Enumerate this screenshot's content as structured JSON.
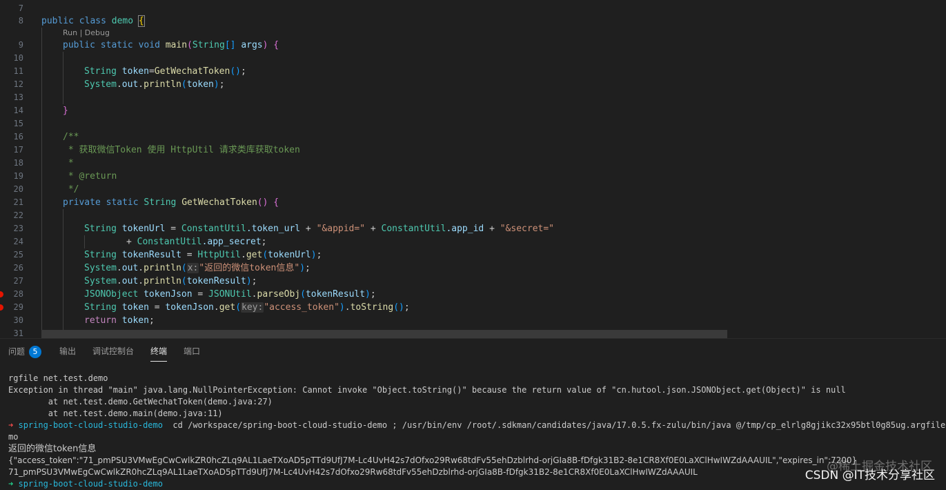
{
  "editor": {
    "line_numbers": [
      "7",
      "8",
      "9",
      "10",
      "11",
      "12",
      "13",
      "14",
      "15",
      "16",
      "17",
      "18",
      "19",
      "20",
      "21",
      "22",
      "23",
      "24",
      "25",
      "26",
      "27",
      "28",
      "29",
      "30",
      "31"
    ],
    "codelens": "Run | Debug",
    "code": {
      "l8": {
        "kw1": "public",
        "kw2": "class",
        "name": "demo",
        "brace": "{"
      },
      "l9": {
        "kw1": "public",
        "kw2": "static",
        "kw3": "void",
        "fn": "main",
        "p1": "(",
        "type": "String",
        "arr": "[]",
        "arg": "args",
        "p2": ")",
        "brace": "{"
      },
      "l11": {
        "type": "String",
        "var": "token",
        "eq": "=",
        "fn": "GetWechatToken",
        "paren": "()",
        "semi": ";"
      },
      "l12": {
        "cls": "System",
        "dot1": ".",
        "field": "out",
        "dot2": ".",
        "fn": "println",
        "p1": "(",
        "arg": "token",
        "p2": ")",
        "semi": ";"
      },
      "l14": {
        "brace": "}"
      },
      "l16": "/**",
      "l17": " * 获取微信Token 使用 HttpUtil 请求类库获取token",
      "l18": " *",
      "l19": " * @return",
      "l20": " */",
      "l21": {
        "kw1": "private",
        "kw2": "static",
        "type": "String",
        "fn": "GetWechatToken",
        "paren": "()",
        "brace": "{"
      },
      "l23": {
        "type": "String",
        "var": "tokenUrl",
        "eq": " = ",
        "cls1": "ConstantUtil",
        "f1": ".token_url",
        "plus1": " + ",
        "s1": "\"&appid=\"",
        "plus2": " + ",
        "cls2": "ConstantUtil",
        "f2": ".app_id",
        "plus3": " + ",
        "s2": "\"&secret=\""
      },
      "l24": {
        "plus": "+ ",
        "cls": "ConstantUtil",
        "f": ".app_secret",
        "semi": ";"
      },
      "l25": {
        "type": "String",
        "var": "tokenResult",
        "eq": " = ",
        "cls": "HttpUtil",
        "dot": ".",
        "fn": "get",
        "p1": "(",
        "arg": "tokenUrl",
        "p2": ")",
        "semi": ";"
      },
      "l26": {
        "cls": "System",
        "dot1": ".",
        "field": "out",
        "dot2": ".",
        "fn": "println",
        "p1": "(",
        "hint": "x:",
        "str": "\"返回的微信token信息\"",
        "p2": ")",
        "semi": ";"
      },
      "l27": {
        "cls": "System",
        "dot1": ".",
        "field": "out",
        "dot2": ".",
        "fn": "println",
        "p1": "(",
        "arg": "tokenResult",
        "p2": ")",
        "semi": ";"
      },
      "l28": {
        "type": "JSONObject",
        "var": "tokenJson",
        "eq": " = ",
        "cls": "JSONUtil",
        "dot": ".",
        "fn": "parseObj",
        "p1": "(",
        "arg": "tokenResult",
        "p2": ")",
        "semi": ";"
      },
      "l29": {
        "type": "String",
        "var": "token",
        "eq": " = ",
        "obj": "tokenJson",
        "dot": ".",
        "fn": "get",
        "p1": "(",
        "hint": "key:",
        "str": "\"access_token\"",
        "p2": ")",
        "dot2": ".",
        "fn2": "toString",
        "paren": "()",
        "semi": ";"
      },
      "l30": {
        "kw": "return",
        "var": "token",
        "semi": ";"
      }
    }
  },
  "panel": {
    "tabs": [
      {
        "label": "问题",
        "badge": "5"
      },
      {
        "label": "输出"
      },
      {
        "label": "调试控制台"
      },
      {
        "label": "终端",
        "active": true
      },
      {
        "label": "端口"
      }
    ],
    "terminal": {
      "l1": "rgfile net.test.demo",
      "l2": "Exception in thread \"main\" java.lang.NullPointerException: Cannot invoke \"Object.toString()\" because the return value of \"cn.hutool.json.JSONObject.get(Object)\" is null",
      "l3": "        at net.test.demo.GetWechatToken(demo.java:27)",
      "l4": "        at net.test.demo.main(demo.java:11)",
      "l5_arrow": "➜",
      "l5_proj": "spring-boot-cloud-studio-demo",
      "l5_cmd": "  cd /workspace/spring-boot-cloud-studio-demo ; /usr/bin/env /root/.sdkman/candidates/java/17.0.5.fx-zulu/bin/java @/tmp/cp_elrlg8gjikc32x95btl0g85ug.argfile net.de",
      "l6": "mo",
      "l7": "返回的微信token信息",
      "l8": "{\"access_token\":\"71_pmPSU3VMwEgCwCwlkZR0hcZLq9AL1LaeTXoAD5pTTd9UfJ7M-Lc4UvH42s7dOfxo29Rw68tdFv55ehDzblrhd-orjGIa8B-fDfgk31B2-8e1CR8Xf0E0LaXClHwIWZdAAAUIL\",\"expires_in\":7200}",
      "l9": "71_pmPSU3VMwEgCwCwlkZR0hcZLq9AL1LaeTXoAD5pTTd9UfJ7M-Lc4UvH42s7dOfxo29Rw68tdFv55ehDzblrhd-orjGIa8B-fDfgk31B2-8e1CR8Xf0E0LaXClHwIWZdAAAUIL",
      "l10_arrow": "➜",
      "l10_proj": "spring-boot-cloud-studio-demo"
    }
  },
  "watermark": {
    "primary": "CSDN @IT技术分享社区",
    "secondary": "@稀土掘金技术社区"
  }
}
